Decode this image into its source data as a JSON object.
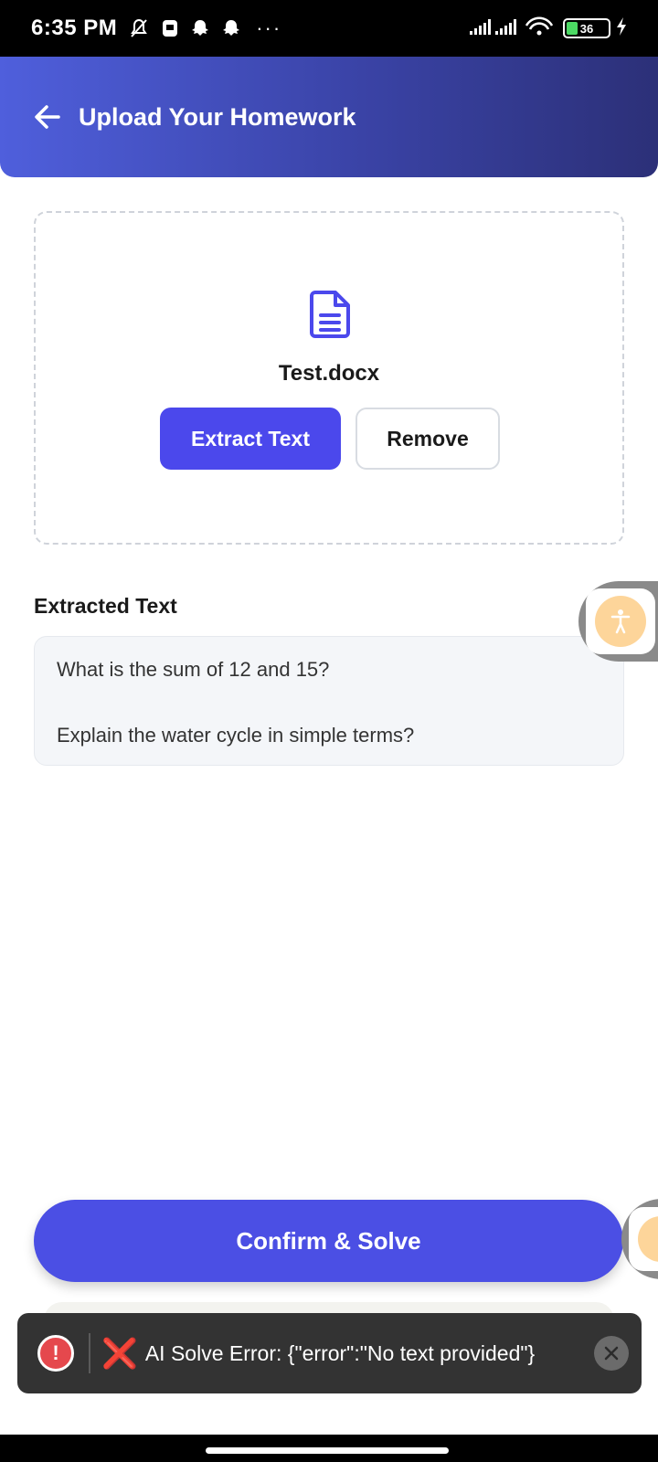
{
  "status_bar": {
    "time": "6:35 PM",
    "battery": "36"
  },
  "header": {
    "title": "Upload Your Homework"
  },
  "upload": {
    "file_name": "Test.docx",
    "extract_label": "Extract Text",
    "remove_label": "Remove"
  },
  "extracted": {
    "label": "Extracted Text",
    "lines": [
      "What is the sum of 12 and 15?",
      "Explain the water cycle in simple terms?"
    ]
  },
  "actions": {
    "confirm_label": "Confirm & Solve"
  },
  "toast": {
    "x_mark": "❌",
    "message": "AI Solve Error: {\"error\":\"No text provided\"}"
  },
  "colors": {
    "accent": "#4b48ec",
    "header_start": "#4f5fdc",
    "header_end": "#2c3078",
    "error": "#e5484d"
  }
}
